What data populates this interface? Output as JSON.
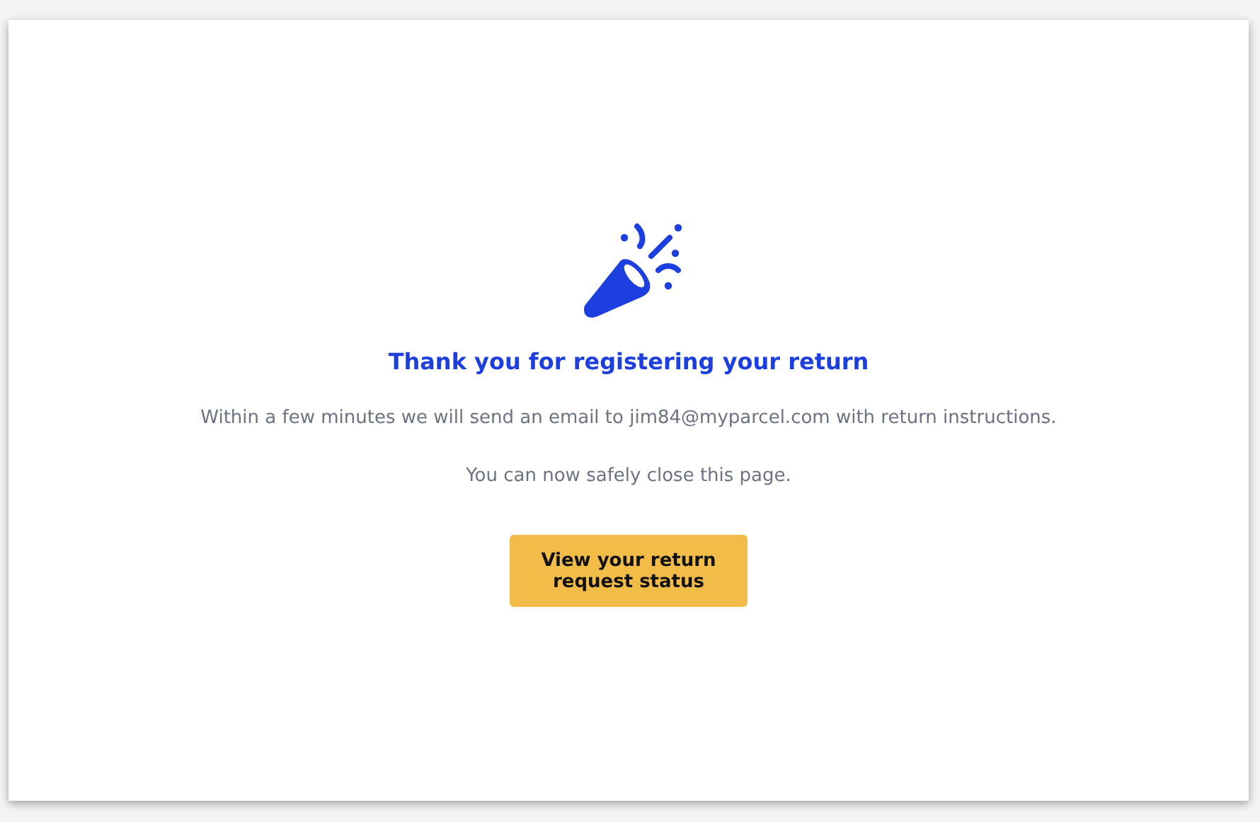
{
  "title": "Thank you for registering your return",
  "message": "Within a few minutes we will send an email to jim84@myparcel.com with return instructions.",
  "note": "You can now safely close this page.",
  "button": "View your return request status"
}
